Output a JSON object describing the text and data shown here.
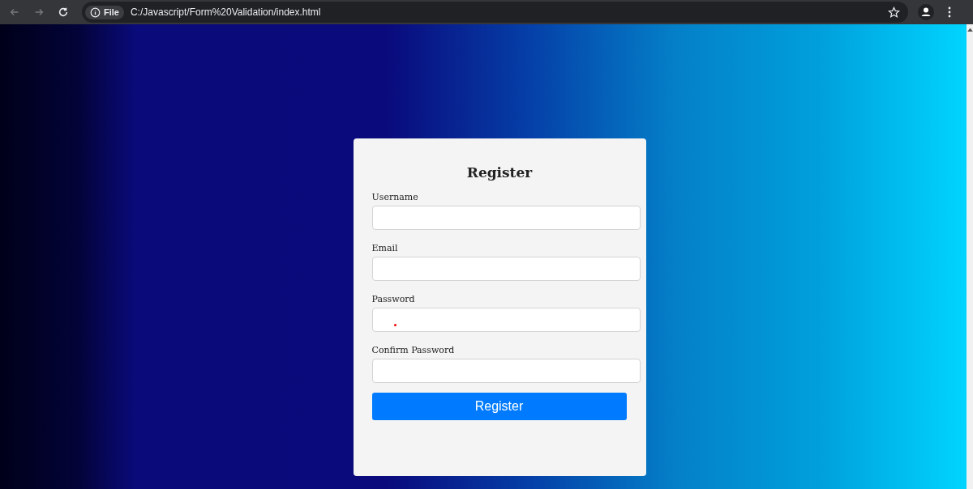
{
  "browser": {
    "site_info": "File",
    "address": "C:/Javascript/Form%20Validation/index.html"
  },
  "form": {
    "title": "Register",
    "fields": [
      {
        "label": "Username",
        "kind": "text"
      },
      {
        "label": "Email",
        "kind": "text"
      },
      {
        "label": "Password",
        "kind": "password"
      },
      {
        "label": "Confirm Password",
        "kind": "text"
      }
    ],
    "submit": "Register"
  }
}
